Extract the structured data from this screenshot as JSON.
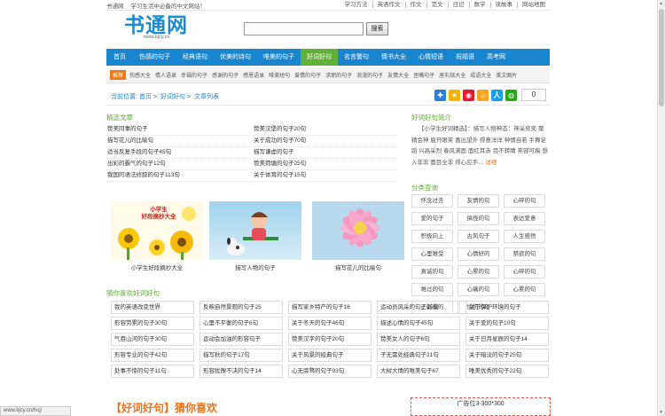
{
  "topbar": {
    "site": "书通网",
    "slogan": "学习生活中必备的中文网站！",
    "links": [
      "学习方法",
      "英语作文",
      "作文",
      "范文",
      "日记",
      "数学",
      "读故事",
      "网站地图"
    ]
  },
  "header": {
    "logo_text": "书通网",
    "logo_url": "www.kjcy.cn",
    "search_value": "",
    "search_button": "搜索"
  },
  "nav": {
    "items": [
      "首页",
      "伤感的句子",
      "经典语句",
      "优美的诗句",
      "唯美的句子",
      "好词好句",
      "名言警句",
      "情书大全",
      "心情短语",
      "祝福语",
      "高考网"
    ],
    "active_index": 5
  },
  "subnav": {
    "tag": "推荐",
    "items": [
      "伤感大全",
      "情人语录",
      "幸福的句子",
      "感谢的句子",
      "感恩语录",
      "唯美短句",
      "爱情的句子",
      "求职的句子",
      "浪漫的句子",
      "友情大全",
      "歪嘴句子",
      "座右铭大全",
      "成语大全",
      "美文图片"
    ]
  },
  "breadcrumb": {
    "prefix": "当前位置:",
    "home": "首页",
    "cat": "好词好句",
    "current": "文章列表"
  },
  "share": {
    "count": "0"
  },
  "left": {
    "title": "精选文章",
    "articles": [
      [
        "赞美同事的句子",
        "赞美汉堡的句子20句"
      ],
      [
        "描写花儿的比喻句",
        "关于成功的句子70句"
      ],
      [
        "适当反复手段的句子45句",
        "描写谦虚的句子"
      ],
      [
        "出彩的霸气的句子12句",
        "赞美荷塘的句子25句"
      ],
      [
        "我国的语法修辞的句子113句",
        "关于体育的句子15句"
      ]
    ],
    "cards": [
      {
        "caption": "小学生好段摘抄大全",
        "img_text": "小学生\n好段摘抄大全"
      },
      {
        "caption": "描写人物的句子"
      },
      {
        "caption": "描写花儿的比喻句"
      }
    ]
  },
  "right": {
    "title": "好词好句简介",
    "intro": "【小学生好词精选】：描写人物神态：神采奕奕 聚精会神 眉开眼笑 喜出望外 得意洋洋 神情自若 手舞足蹈 兴高采烈 春风满面 面红耳赤 目不转睛 笑容可掬 想入非非 面目全非 得心应手…",
    "more": "详细",
    "cats_title": "分类查询",
    "cats": [
      "怀念过去",
      "友情的句",
      "心碎的句",
      "爱的句子",
      "搞怪的句",
      "表达爱意",
      "积极向上",
      "古风句子",
      "人生感悟",
      "心里难受",
      "心情好的",
      "禁欲的句",
      "真诚的句",
      "心累的句",
      "心碎的句",
      "难过的句",
      "心痛的句",
      "心累的句",
      "正能量的",
      "忧伤的句"
    ]
  },
  "hot": {
    "title": "猜你喜欢好词好句",
    "items": [
      "我的英语改变世界",
      "反映自然景观的句子25",
      "描写家乡特产的句子18",
      "运动员风采的句子25句",
      "关于保护环境的句子",
      "形容劳累的句子30句",
      "心里不平衡的句子6句",
      "关于冬天的句子46句",
      "描述心情的句子45句",
      "关于爱的句子10句",
      "气吞山河的句子30句",
      "运动会加油的形容句子",
      "赞美汉字的句子20句",
      "赞美女人的句子6句",
      "关于日月星辰的句子14",
      "形容专业的句子42句",
      "描写秋的句子17句",
      "关于风景的经典句子",
      "子无需处经典句子21句",
      "关于暗淡的句子25句",
      "处事不惊的句子11句",
      "形容犹豫不决的句子14",
      "心无旁骛的句子93句",
      "大树大情的唯美句子67",
      "唯美优秀的句子22句"
    ]
  },
  "bottom": {
    "title": "【好词好句】猜你喜欢"
  },
  "ad": {
    "label": "广告位3-300*300"
  },
  "status": {
    "url": "www.kjcy.cn/hcj/"
  },
  "colors": {
    "brand_blue": "#1a85cf",
    "active_green": "#61b13a",
    "section_green": "#61a836",
    "orange": "#f07a12"
  }
}
